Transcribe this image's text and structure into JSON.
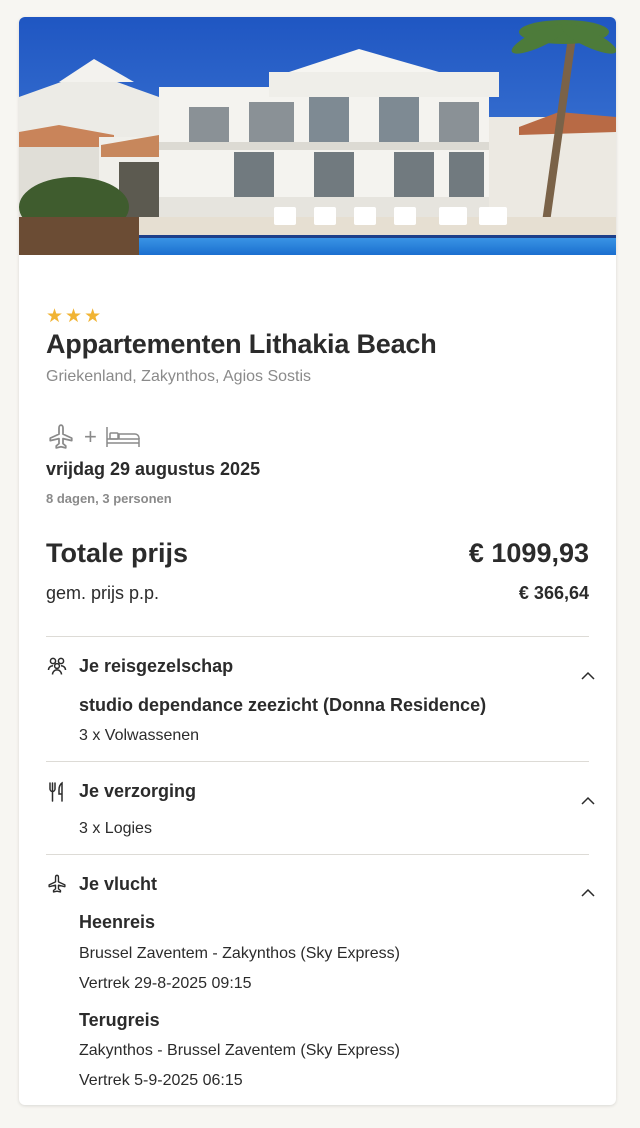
{
  "hotel": {
    "stars": 3,
    "star_glyph": "★",
    "name": "Appartementen Lithakia Beach",
    "location": [
      "Griekenland,",
      "Zakynthos,",
      "Agios Sostis"
    ]
  },
  "trip": {
    "icons": [
      "plane-icon",
      "bed-icon"
    ],
    "plus": "+",
    "date": "vrijdag 29 augustus 2025",
    "duration": "8 dagen, 3 personen"
  },
  "price": {
    "total_label": "Totale prijs",
    "total_value": "€ 1099,93",
    "pp_label": "gem. prijs p.p.",
    "pp_value": "€ 366,64"
  },
  "sections": {
    "company": {
      "icon": "group-icon",
      "title": "Je reisgezelschap",
      "room": "studio dependance zeezicht (Donna Residence)",
      "travellers": "3 x Volwassenen"
    },
    "meals": {
      "icon": "fork-knife-icon",
      "title": "Je verzorging",
      "board": "3 x Logies"
    },
    "flight": {
      "icon": "plane-icon",
      "title": "Je vlucht",
      "outbound_label": "Heenreis",
      "outbound_route": "Brussel Zaventem - Zakynthos (Sky Express)",
      "outbound_departure": "Vertrek 29-8-2025 09:15",
      "return_label": "Terugreis",
      "return_route": "Zakynthos - Brussel Zaventem (Sky Express)",
      "return_departure": "Vertrek 5-9-2025 06:15"
    }
  },
  "colors": {
    "star": "#f1b434",
    "text": "#2b2b2b",
    "muted": "#8a8a8a",
    "sky": "#2f66c9",
    "pool": "#2d7fd8"
  }
}
